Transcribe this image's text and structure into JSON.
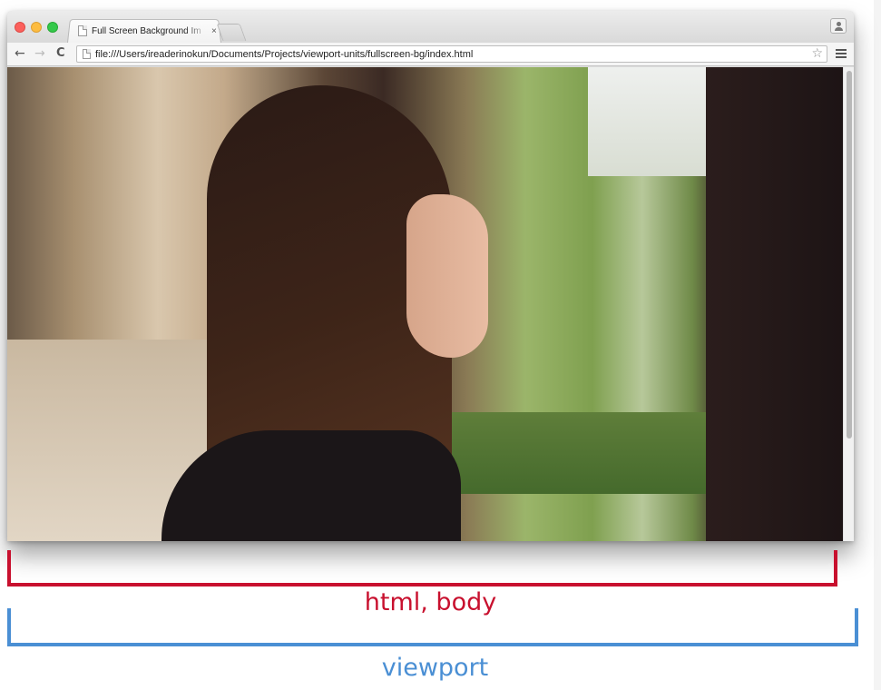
{
  "browser": {
    "tab_title": "Full Screen Background Im",
    "tab_close": "×",
    "url": "file:///Users/ireaderinokun/Documents/Projects/viewport-units/fullscreen-bg/index.html",
    "nav": {
      "back": "←",
      "forward": "→",
      "reload": "C"
    },
    "star": "☆"
  },
  "annotations": {
    "html_body_label": "html, body",
    "viewport_label": "viewport",
    "html_body_color": "#c8102e",
    "viewport_color": "#4a8fd4"
  },
  "icons": [
    "document-icon",
    "close-icon",
    "profile-icon",
    "back-arrow-icon",
    "forward-arrow-icon",
    "reload-icon",
    "star-icon",
    "menu-icon"
  ]
}
